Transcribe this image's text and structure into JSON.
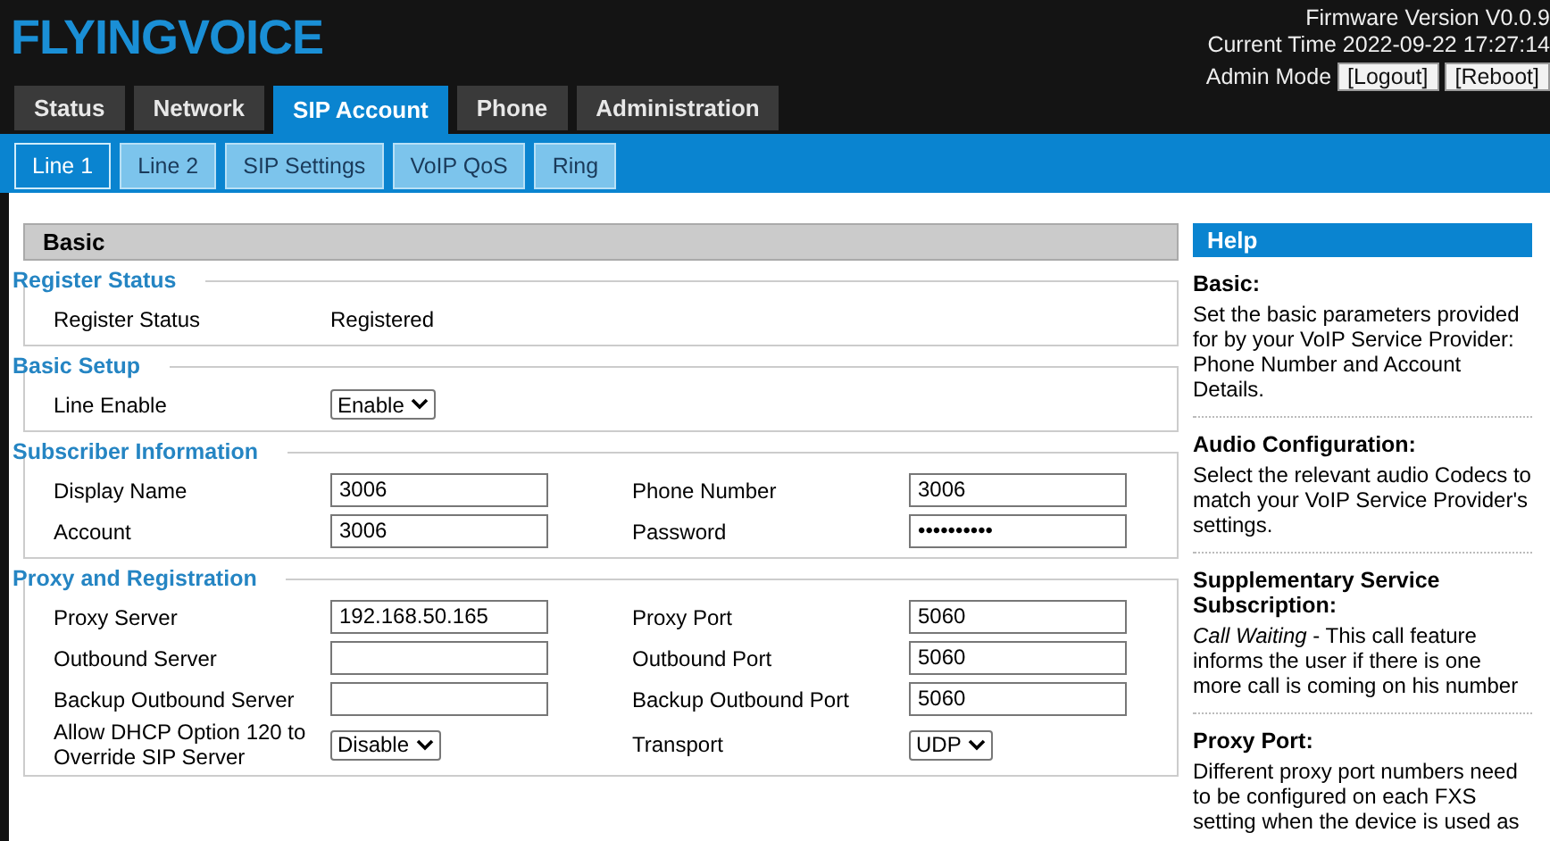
{
  "header": {
    "logo": "FLYINGVOICE",
    "firmware": "Firmware Version V0.0.9",
    "current_time": "Current Time 2022-09-22 17:27:14",
    "mode": "Admin Mode",
    "buttons": [
      "[Logout]",
      "[Reboot]"
    ]
  },
  "tabs": [
    {
      "label": "Status",
      "selected": false
    },
    {
      "label": "Network",
      "selected": false
    },
    {
      "label": "SIP Account",
      "selected": true
    },
    {
      "label": "Phone",
      "selected": false
    },
    {
      "label": "Administration",
      "selected": false
    }
  ],
  "subtabs": [
    {
      "label": "Line 1",
      "selected": true
    },
    {
      "label": "Line 2",
      "selected": false
    },
    {
      "label": "SIP Settings",
      "selected": false
    },
    {
      "label": "VoIP QoS",
      "selected": false
    },
    {
      "label": "Ring",
      "selected": false
    }
  ],
  "panel_title": "Basic",
  "sections": [
    {
      "title": "Register Status",
      "rows": [
        [
          {
            "label": "Register Status",
            "kind": "text",
            "value": "Registered"
          }
        ]
      ]
    },
    {
      "title": "Basic Setup",
      "rows": [
        [
          {
            "label": "Line Enable",
            "kind": "select",
            "value": "Enable"
          }
        ]
      ]
    },
    {
      "title": "Subscriber Information",
      "rows": [
        [
          {
            "label": "Display Name",
            "kind": "input",
            "value": "3006"
          },
          {
            "label": "Phone Number",
            "kind": "input",
            "value": "3006"
          }
        ],
        [
          {
            "label": "Account",
            "kind": "input",
            "value": "3006"
          },
          {
            "label": "Password",
            "kind": "input",
            "value": "••••••••••"
          }
        ]
      ]
    },
    {
      "title": "Proxy and Registration",
      "rows": [
        [
          {
            "label": "Proxy Server",
            "kind": "input",
            "value": "192.168.50.165"
          },
          {
            "label": "Proxy Port",
            "kind": "input",
            "value": "5060"
          }
        ],
        [
          {
            "label": "Outbound Server",
            "kind": "input"
          },
          {
            "label": "Outbound Port",
            "kind": "input",
            "value": "5060"
          }
        ],
        [
          {
            "label": "Backup Outbound Server",
            "kind": "input"
          },
          {
            "label": "Backup Outbound Port",
            "kind": "input",
            "value": "5060"
          }
        ],
        [
          {
            "label": "Allow DHCP Option 120 to Override SIP Server",
            "kind": "select",
            "value": "Disable"
          },
          {
            "label": "Transport",
            "kind": "select",
            "value": "UDP"
          }
        ]
      ]
    }
  ],
  "help": {
    "title": "Help",
    "items": [
      {
        "title": "Basic:",
        "text": "Set the basic parameters provided for by your VoIP Service Provider: Phone Number and Account Details."
      },
      {
        "title": "Audio Configuration:",
        "text": "Select the relevant audio Codecs to match your VoIP Service Provider's settings."
      },
      {
        "title": "Supplementary Service Subscription:",
        "text": "*Call Waiting* - This call feature informs the user if there is one more call is coming on his number"
      },
      {
        "title": "Proxy Port:",
        "text": "Different proxy port numbers need to be configured on each FXS setting when the device is used as"
      }
    ]
  }
}
